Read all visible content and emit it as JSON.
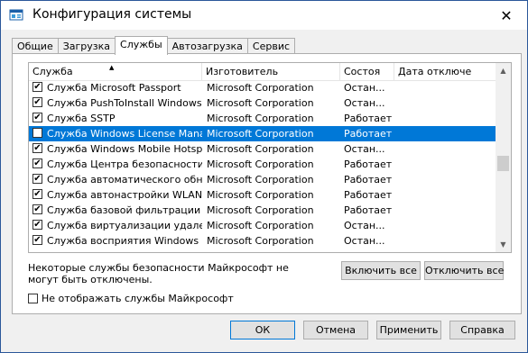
{
  "window": {
    "title": "Конфигурация системы",
    "close_glyph": "✕"
  },
  "tabs": [
    {
      "label": "Общие"
    },
    {
      "label": "Загрузка"
    },
    {
      "label": "Службы"
    },
    {
      "label": "Автозагрузка"
    },
    {
      "label": "Сервис"
    }
  ],
  "columns": {
    "name": "Служба",
    "maker": "Изготовитель",
    "status": "Состоя",
    "date": "Дата отключе"
  },
  "rows": [
    {
      "checked": true,
      "name": "Служба Microsoft Passport",
      "maker": "Microsoft Corporation",
      "status": "Остан...",
      "date": ""
    },
    {
      "checked": true,
      "name": "Служба PushToInstall Windows",
      "maker": "Microsoft Corporation",
      "status": "Остан...",
      "date": ""
    },
    {
      "checked": true,
      "name": "Служба SSTP",
      "maker": "Microsoft Corporation",
      "status": "Работает",
      "date": ""
    },
    {
      "checked": false,
      "name": "Служба Windows License Manager",
      "maker": "Microsoft Corporation",
      "status": "Работает",
      "date": "",
      "selected": true
    },
    {
      "checked": true,
      "name": "Служба Windows Mobile Hotspot",
      "maker": "Microsoft Corporation",
      "status": "Остан...",
      "date": ""
    },
    {
      "checked": true,
      "name": "Служба Центра безопасности ...",
      "maker": "Microsoft Corporation",
      "status": "Работает",
      "date": ""
    },
    {
      "checked": true,
      "name": "Служба автоматического обн...",
      "maker": "Microsoft Corporation",
      "status": "Работает",
      "date": ""
    },
    {
      "checked": true,
      "name": "Служба автонастройки WLAN",
      "maker": "Microsoft Corporation",
      "status": "Работает",
      "date": ""
    },
    {
      "checked": true,
      "name": "Служба базовой фильтрации",
      "maker": "Microsoft Corporation",
      "status": "Работает",
      "date": ""
    },
    {
      "checked": true,
      "name": "Служба виртуализации удале...",
      "maker": "Microsoft Corporation",
      "status": "Остан...",
      "date": ""
    },
    {
      "checked": true,
      "name": "Служба восприятия Windows",
      "maker": "Microsoft Corporation",
      "status": "Остан...",
      "date": ""
    }
  ],
  "note": "Некоторые службы безопасности Майкрософт не могут быть отключены.",
  "buttons": {
    "enable_all": "Включить все",
    "disable_all": "Отключить все",
    "ok": "ОК",
    "cancel": "Отмена",
    "apply": "Применить",
    "help": "Справка"
  },
  "hide_ms_services": {
    "label": "Не отображать службы Майкрософт",
    "checked": false
  },
  "icons": {
    "app": "msconfig-icon",
    "sort": "sort-ascending-icon",
    "scroll_up": "scroll-up-icon",
    "scroll_down": "scroll-down-icon"
  },
  "colors": {
    "selection": "#0078d7",
    "window_border": "#2b579a"
  }
}
